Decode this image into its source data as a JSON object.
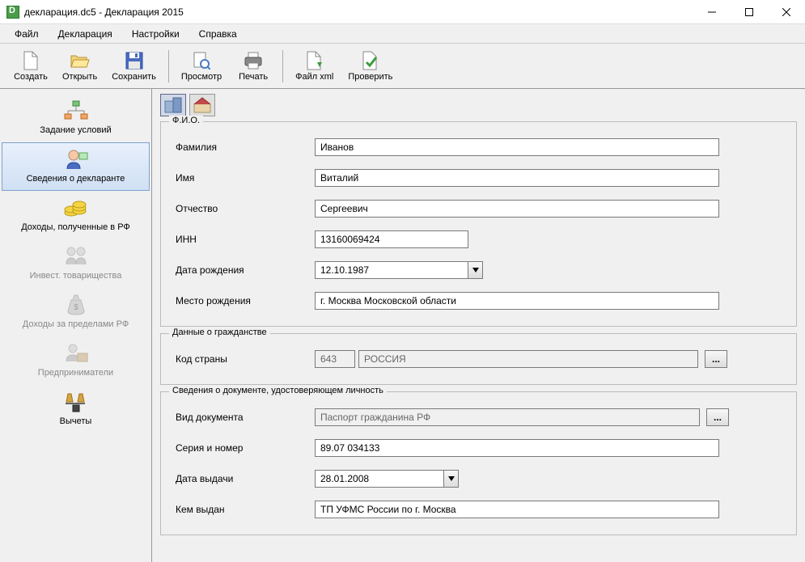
{
  "window": {
    "title": "декларация.dc5 - Декларация 2015"
  },
  "menu": {
    "file": "Файл",
    "declaration": "Декларация",
    "settings": "Настройки",
    "help": "Справка"
  },
  "toolbar": {
    "create": "Создать",
    "open": "Открыть",
    "save": "Сохранить",
    "preview": "Просмотр",
    "print": "Печать",
    "file_xml": "Файл xml",
    "check": "Проверить"
  },
  "sidebar": {
    "items": [
      {
        "label": "Задание условий"
      },
      {
        "label": "Сведения о декларанте"
      },
      {
        "label": "Доходы, полученные в РФ"
      },
      {
        "label": "Инвест. товарищества"
      },
      {
        "label": "Доходы за пределами РФ"
      },
      {
        "label": "Предприниматели"
      },
      {
        "label": "Вычеты"
      }
    ]
  },
  "groups": {
    "fio": "Ф.И.О.",
    "citizenship": "Данные о гражданстве",
    "identity": "Сведения о документе, удостоверяющем личность"
  },
  "labels": {
    "surname": "Фамилия",
    "name": "Имя",
    "patronymic": "Отчество",
    "inn": "ИНН",
    "birth_date": "Дата рождения",
    "birth_place": "Место рождения",
    "country_code": "Код страны",
    "doc_type": "Вид документа",
    "series_number": "Серия и номер",
    "issue_date": "Дата выдачи",
    "issued_by": "Кем выдан"
  },
  "values": {
    "surname": "Иванов",
    "name": "Виталий",
    "patronymic": "Сергеевич",
    "inn": "13160069424",
    "birth_date": "12.10.1987",
    "birth_place": "г. Москва Московской области",
    "country_code": "643",
    "country_name": "РОССИЯ",
    "doc_type": "Паспорт гражданина РФ",
    "series_number": "89.07 034133",
    "issue_date": "28.01.2008",
    "issued_by": "ТП УФМС России по г. Москва"
  },
  "browse": "..."
}
